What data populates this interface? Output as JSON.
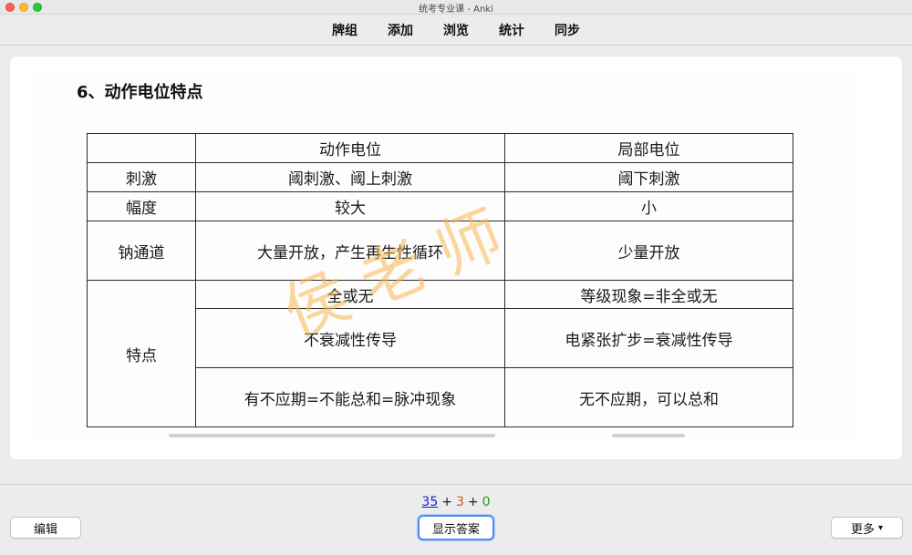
{
  "window": {
    "title": "统考专业课 - Anki"
  },
  "toolbar": {
    "items": [
      "牌组",
      "添加",
      "浏览",
      "统计",
      "同步"
    ]
  },
  "card": {
    "heading": "6、动作电位特点",
    "table": {
      "header": [
        "",
        "动作电位",
        "局部电位"
      ],
      "rows": {
        "stimulus": [
          "刺激",
          "阈刺激、阈上刺激",
          "阈下刺激"
        ],
        "amplitude": [
          "幅度",
          "较大",
          "小"
        ],
        "channel": [
          "钠通道",
          "大量开放，产生再生性循环",
          "少量开放"
        ],
        "feature_label": "特点",
        "features": [
          [
            "全或无",
            "等级现象=非全或无"
          ],
          [
            "不衰减性传导",
            "电紧张扩步=衰减性传导"
          ],
          [
            "有不应期=不能总和=脉冲现象",
            "无不应期，可以总和"
          ]
        ]
      }
    },
    "watermark": "侯老师"
  },
  "counts": {
    "new": "35",
    "learning": "3",
    "review": "0",
    "plus": "+"
  },
  "buttons": {
    "edit": "编辑",
    "show_answer": "显示答案",
    "more": "更多",
    "more_icon": "▾"
  },
  "colors": {
    "new": "#1a1ad6",
    "learning": "#d2521b",
    "review": "#1aa01a",
    "focus": "#4a8df6"
  }
}
